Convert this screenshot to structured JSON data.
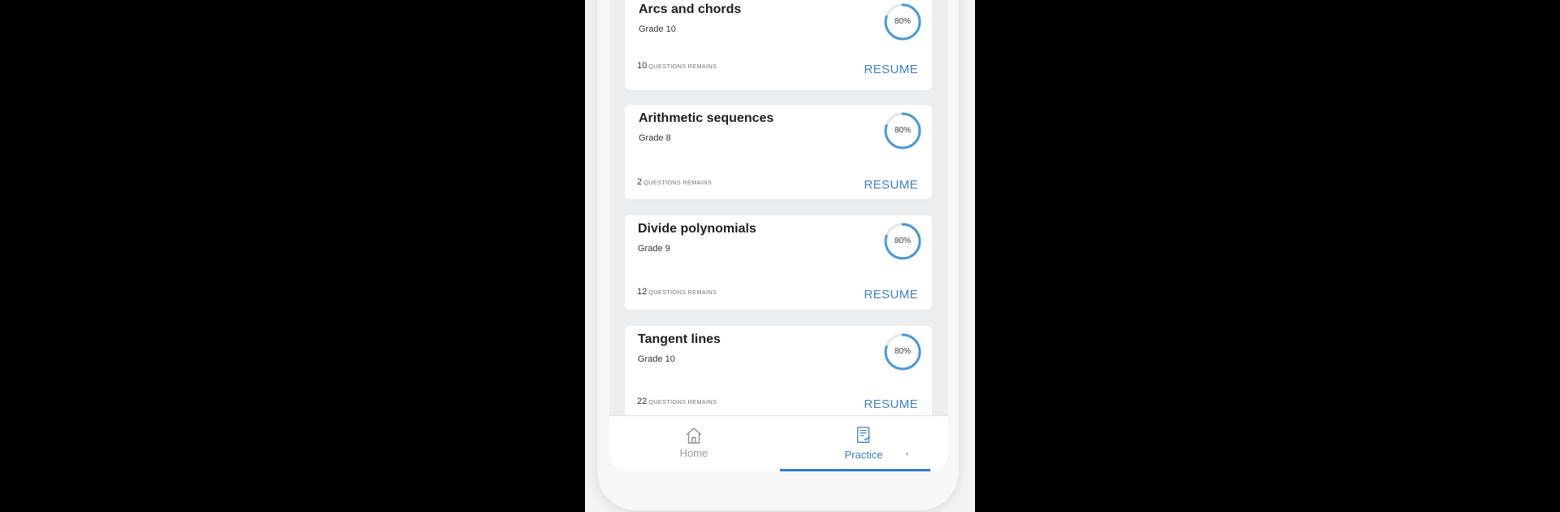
{
  "colors": {
    "accent": "#3d7fc4",
    "progress_ring": "#4a9ad6",
    "progress_track": "#e3e6ea",
    "active_tab_bar": "#2f7cc8"
  },
  "cards": [
    {
      "title": "Arcs and chords",
      "grade": "Grade 10",
      "progress": 80,
      "progress_label": "80%",
      "remaining": "10",
      "remaining_unit": "QUESTIONS REMAINS",
      "action": "RESUME"
    },
    {
      "title": "Arithmetic sequences",
      "grade": "Grade 8",
      "progress": 80,
      "progress_label": "80%",
      "remaining": "2",
      "remaining_unit": "QUESTIONS REMAINS",
      "action": "RESUME"
    },
    {
      "title": "Divide polynomials",
      "grade": "Grade 9",
      "progress": 80,
      "progress_label": "80%",
      "remaining": "12",
      "remaining_unit": "QUESTIONS REMAINS",
      "action": "RESUME"
    },
    {
      "title": "Tangent lines",
      "grade": "Grade 10",
      "progress": 80,
      "progress_label": "80%",
      "remaining": "22",
      "remaining_unit": "QUESTIONS REMAINS",
      "action": "RESUME"
    }
  ],
  "tabs": [
    {
      "label": "Home",
      "icon": "home-icon",
      "active": false
    },
    {
      "label": "Practice",
      "icon": "worksheet-icon",
      "active": true
    }
  ]
}
